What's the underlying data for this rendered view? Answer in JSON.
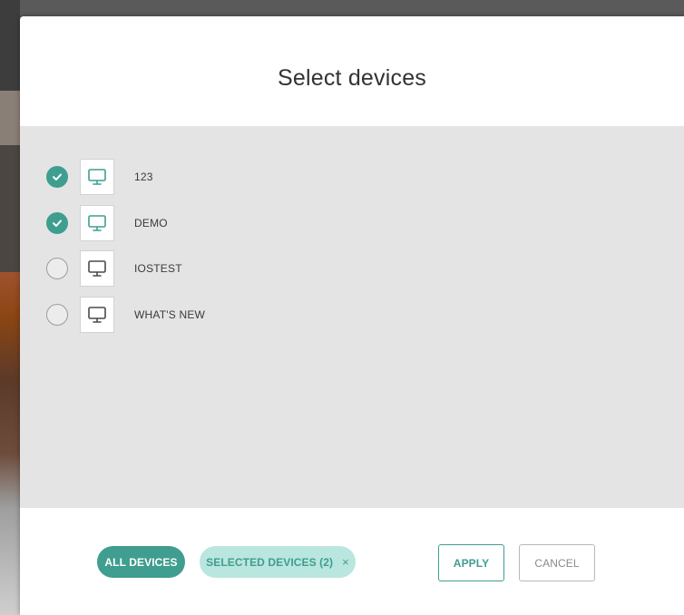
{
  "dialog": {
    "title": "Select devices"
  },
  "devices": [
    {
      "name": "123",
      "selected": true,
      "icon": "monitor-icon"
    },
    {
      "name": "DEMO",
      "selected": true,
      "icon": "monitor-icon"
    },
    {
      "name": "IOSTEST",
      "selected": false,
      "icon": "monitor-icon"
    },
    {
      "name": "WHAT'S NEW",
      "selected": false,
      "icon": "monitor-icon"
    }
  ],
  "footer": {
    "all_devices_label": "ALL DEVICES",
    "selected_devices_label": "SELECTED DEVICES (2)",
    "clear_symbol": "×",
    "apply_label": "APPLY",
    "cancel_label": "CANCEL"
  },
  "colors": {
    "accent": "#3f9e8f",
    "accent_light": "#b9e6de",
    "list_background": "#e4e4e4"
  }
}
